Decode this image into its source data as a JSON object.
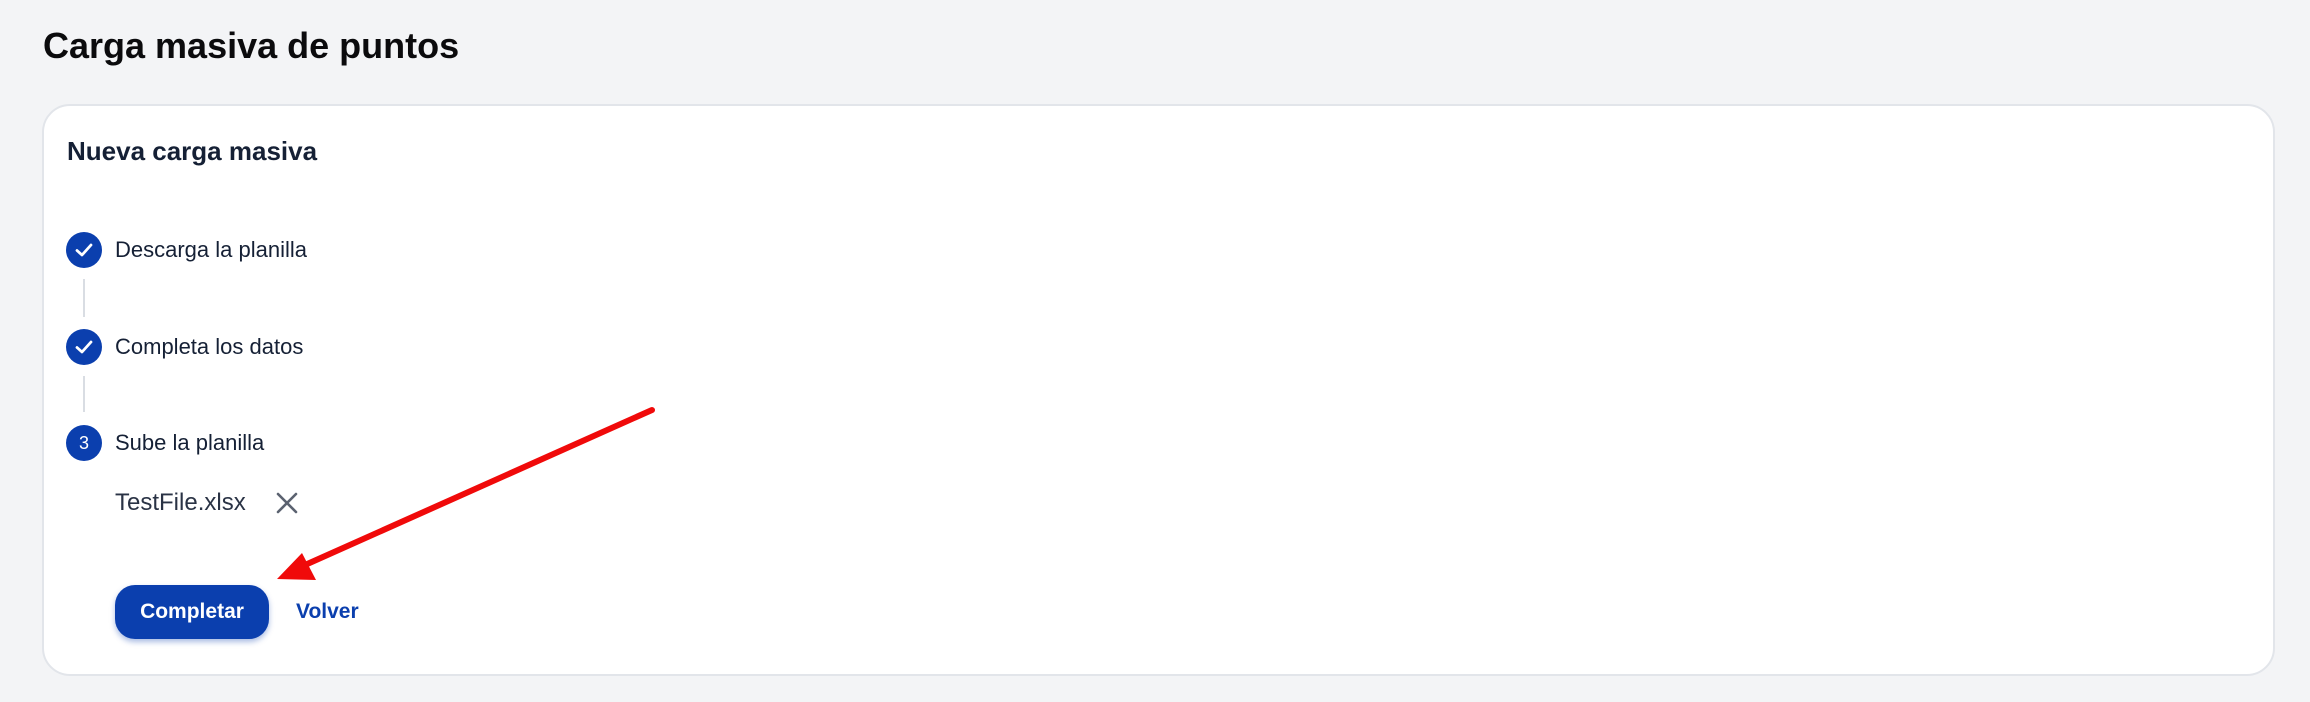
{
  "page": {
    "title": "Carga masiva de puntos"
  },
  "card": {
    "title": "Nueva carga masiva",
    "steps": [
      {
        "label": "Descarga la planilla",
        "status": "completed",
        "icon": "check-icon"
      },
      {
        "label": "Completa los datos",
        "status": "completed",
        "icon": "check-icon"
      },
      {
        "label": "Sube la planilla",
        "status": "current",
        "number": "3"
      }
    ],
    "file": {
      "name": "TestFile.xlsx",
      "remove_icon": "close-icon"
    },
    "actions": {
      "complete_label": "Completar",
      "back_label": "Volver"
    }
  },
  "colors": {
    "accent": "#0b3fae",
    "background": "#f3f4f6",
    "card": "#ffffff",
    "annotation": "#f00a0a"
  }
}
